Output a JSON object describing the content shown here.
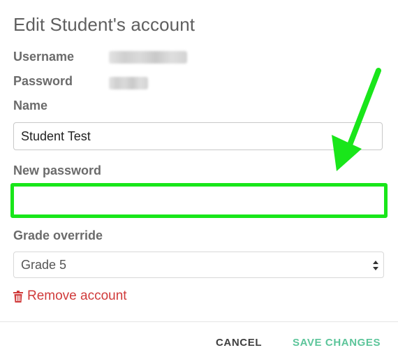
{
  "dialog": {
    "title": "Edit Student's account"
  },
  "fields": {
    "username_label": "Username",
    "password_label": "Password",
    "name_label": "Name",
    "name_value": "Student Test",
    "new_password_label": "New password",
    "new_password_value": "",
    "grade_override_label": "Grade override",
    "grade_override_selected": "Grade 5"
  },
  "actions": {
    "remove_account_label": "Remove account",
    "cancel_label": "CANCEL",
    "save_label": "SAVE CHANGES"
  },
  "colors": {
    "accent_save": "#5cc59a",
    "danger": "#d03b3b",
    "highlight_annotation": "#19e61a"
  },
  "icons": {
    "remove": "trash-icon",
    "select": "chevron-up-down-icon",
    "annotation": "arrow-annotation-icon"
  }
}
